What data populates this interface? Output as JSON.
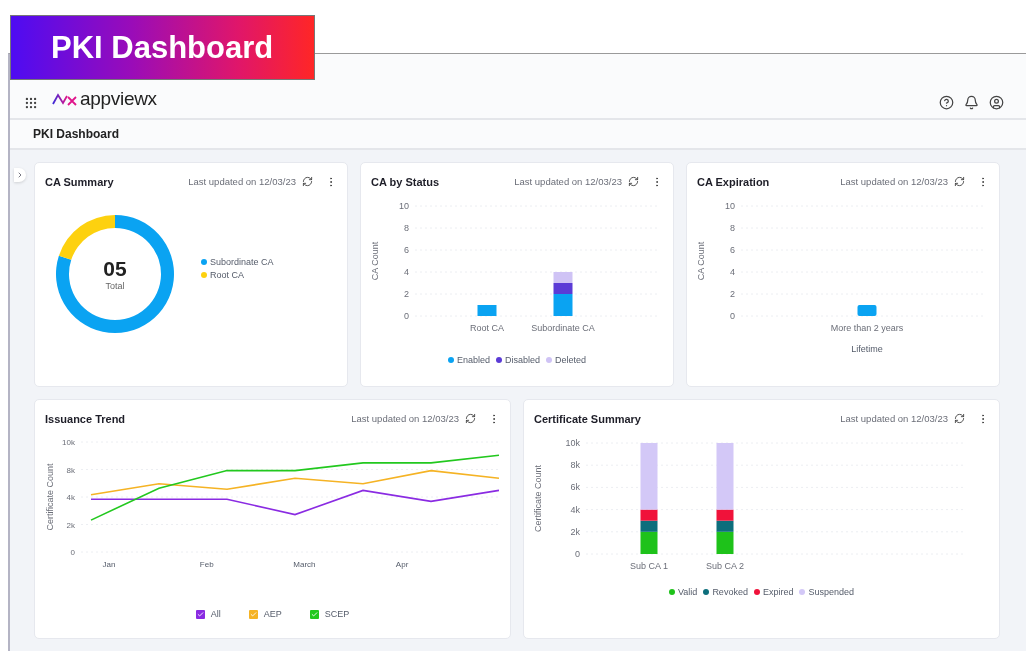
{
  "banner": {
    "title": "PKI Dashboard"
  },
  "header": {
    "logo": "appviewx"
  },
  "page_title": "PKI Dashboard",
  "cards": [
    {
      "title": "CA Summary",
      "updated": "Last updated on 12/03/23",
      "total": "05",
      "total_label": "Total",
      "chart_data": {
        "type": "donut",
        "categories": [
          "Subordinate CA",
          "Root CA"
        ],
        "values": [
          80,
          20
        ],
        "colors": [
          "#0aa3f2",
          "#fdd10f"
        ]
      }
    },
    {
      "title": "CA by Status",
      "updated": "Last updated on 12/03/23",
      "chart_data": {
        "type": "bar",
        "ylabel": "CA Count",
        "grid": true,
        "categories": [
          "Root CA",
          "Subordinate CA"
        ],
        "stacked": true,
        "ylim": [
          0,
          10
        ],
        "yticks": [
          0,
          2,
          4,
          6,
          8,
          10
        ],
        "series": [
          {
            "name": "Enabled",
            "color": "#0aa3f2",
            "values": [
              1,
              2
            ]
          },
          {
            "name": "Disabled",
            "color": "#5b3bd6",
            "values": [
              0,
              1
            ]
          },
          {
            "name": "Deleted",
            "color": "#cfc3f5",
            "values": [
              0,
              1
            ]
          }
        ]
      }
    },
    {
      "title": "CA Expiration",
      "updated": "Last updated on 12/03/23",
      "chart_data": {
        "type": "bar",
        "xlabel": "Lifetime",
        "ylabel": "CA Count",
        "grid": true,
        "categories": [
          "More than 2 years"
        ],
        "ylim": [
          0,
          10
        ],
        "yticks": [
          0,
          2,
          4,
          6,
          8,
          10
        ],
        "series": [
          {
            "color": "#0aa3f2",
            "values": [
              1
            ]
          }
        ]
      }
    },
    {
      "title": "Issuance Trend",
      "updated": "Last updated on 12/03/23",
      "x_axis_labels": [
        "Jan",
        "Feb",
        "March",
        "Apr"
      ],
      "y_axis_labels": [
        "8k",
        "4k",
        "2k"
      ],
      "legend": [
        {
          "checked": true
        },
        {
          "checked": true
        },
        {
          "checked": true
        }
      ],
      "chart_data": {
        "type": "line",
        "ylabel": "Certificate Count",
        "grid": true,
        "categories": [
          null,
          null,
          null,
          null,
          null,
          null,
          null
        ],
        "ylim": [
          0,
          10000
        ],
        "yticks": [
          {
            "value": 0,
            "label": "0"
          },
          {
            "value": 10000,
            "label": "10k"
          }
        ],
        "series": [
          {
            "name": "All",
            "color": "#8a2be2",
            "values": [
              4800,
              4800,
              4800,
              3400,
              5600,
              4600,
              5600
            ]
          },
          {
            "name": "AEP",
            "color": "#f5b324",
            "values": [
              5200,
              6200,
              5700,
              6700,
              6200,
              7400,
              6700
            ]
          },
          {
            "name": "SCEP",
            "color": "#22c81e",
            "values": [
              2900,
              5800,
              7400,
              7400,
              8100,
              8100,
              8800
            ]
          }
        ]
      }
    },
    {
      "title": "Certificate Summary",
      "updated": "Last updated on 12/03/23",
      "chart_data": {
        "type": "bar",
        "ylabel": "Certificate Count",
        "grid": true,
        "categories": [
          "Sub CA 1",
          "Sub CA 2"
        ],
        "stacked": true,
        "ylim": [
          0,
          10000
        ],
        "yticks": [
          {
            "value": 0,
            "label": "0"
          },
          {
            "value": 2000,
            "label": "2k"
          },
          {
            "value": 4000,
            "label": "4k"
          },
          {
            "value": 6000,
            "label": "6k"
          },
          {
            "value": 8000,
            "label": "8k"
          },
          {
            "value": 10000,
            "label": "10k"
          }
        ],
        "series": [
          {
            "name": "Valid",
            "color": "#1ec21a",
            "values": [
              2000,
              2000
            ]
          },
          {
            "name": "Revoked",
            "color": "#0d6e7c",
            "values": [
              1000,
              1000
            ]
          },
          {
            "name": "Expired",
            "color": "#f0123a",
            "values": [
              1000,
              1000
            ]
          },
          {
            "name": "Suspended",
            "color": "#d3c8f7",
            "values": [
              6000,
              6000
            ]
          }
        ]
      }
    }
  ]
}
